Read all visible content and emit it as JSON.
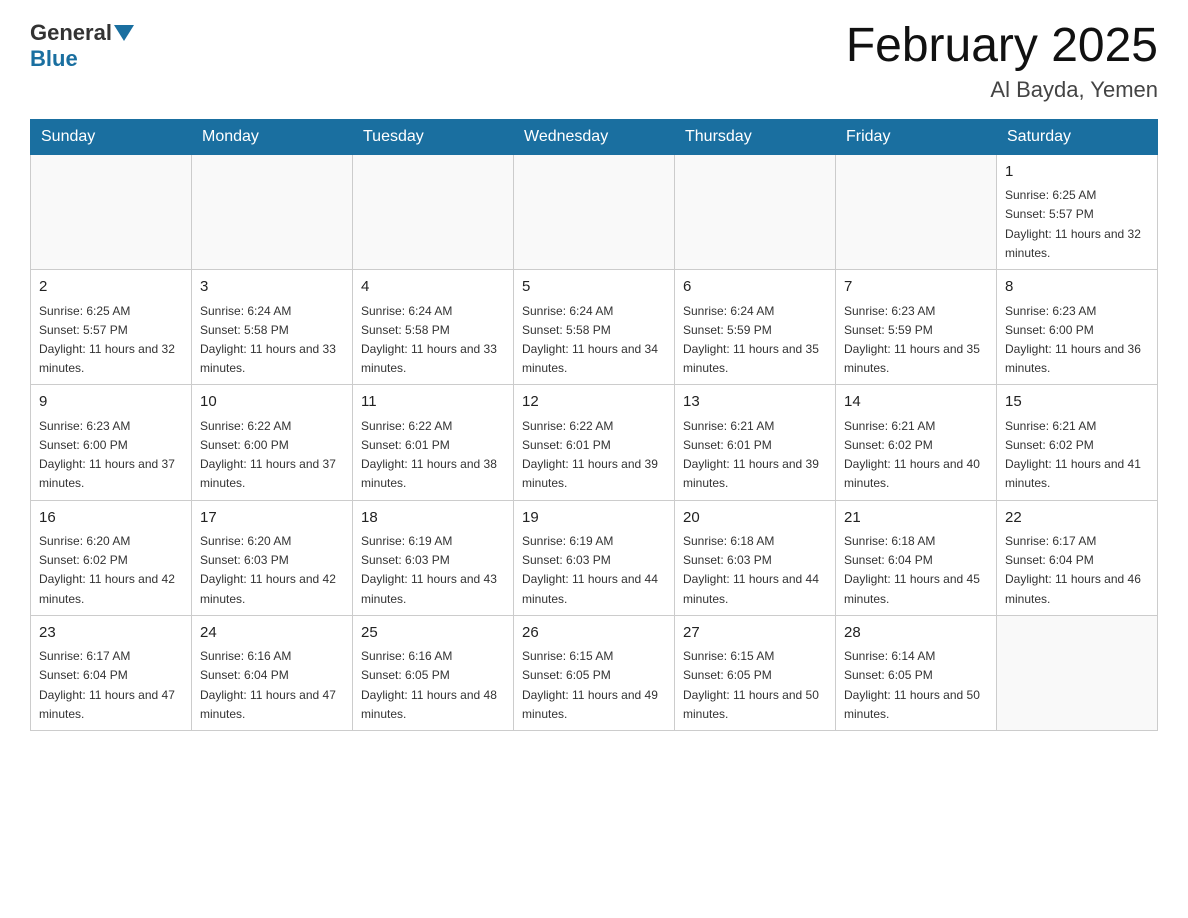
{
  "header": {
    "logo_general": "General",
    "logo_blue": "Blue",
    "title": "February 2025",
    "subtitle": "Al Bayda, Yemen"
  },
  "days_of_week": [
    "Sunday",
    "Monday",
    "Tuesday",
    "Wednesday",
    "Thursday",
    "Friday",
    "Saturday"
  ],
  "weeks": [
    [
      {
        "day": "",
        "info": ""
      },
      {
        "day": "",
        "info": ""
      },
      {
        "day": "",
        "info": ""
      },
      {
        "day": "",
        "info": ""
      },
      {
        "day": "",
        "info": ""
      },
      {
        "day": "",
        "info": ""
      },
      {
        "day": "1",
        "info": "Sunrise: 6:25 AM\nSunset: 5:57 PM\nDaylight: 11 hours and 32 minutes."
      }
    ],
    [
      {
        "day": "2",
        "info": "Sunrise: 6:25 AM\nSunset: 5:57 PM\nDaylight: 11 hours and 32 minutes."
      },
      {
        "day": "3",
        "info": "Sunrise: 6:24 AM\nSunset: 5:58 PM\nDaylight: 11 hours and 33 minutes."
      },
      {
        "day": "4",
        "info": "Sunrise: 6:24 AM\nSunset: 5:58 PM\nDaylight: 11 hours and 33 minutes."
      },
      {
        "day": "5",
        "info": "Sunrise: 6:24 AM\nSunset: 5:58 PM\nDaylight: 11 hours and 34 minutes."
      },
      {
        "day": "6",
        "info": "Sunrise: 6:24 AM\nSunset: 5:59 PM\nDaylight: 11 hours and 35 minutes."
      },
      {
        "day": "7",
        "info": "Sunrise: 6:23 AM\nSunset: 5:59 PM\nDaylight: 11 hours and 35 minutes."
      },
      {
        "day": "8",
        "info": "Sunrise: 6:23 AM\nSunset: 6:00 PM\nDaylight: 11 hours and 36 minutes."
      }
    ],
    [
      {
        "day": "9",
        "info": "Sunrise: 6:23 AM\nSunset: 6:00 PM\nDaylight: 11 hours and 37 minutes."
      },
      {
        "day": "10",
        "info": "Sunrise: 6:22 AM\nSunset: 6:00 PM\nDaylight: 11 hours and 37 minutes."
      },
      {
        "day": "11",
        "info": "Sunrise: 6:22 AM\nSunset: 6:01 PM\nDaylight: 11 hours and 38 minutes."
      },
      {
        "day": "12",
        "info": "Sunrise: 6:22 AM\nSunset: 6:01 PM\nDaylight: 11 hours and 39 minutes."
      },
      {
        "day": "13",
        "info": "Sunrise: 6:21 AM\nSunset: 6:01 PM\nDaylight: 11 hours and 39 minutes."
      },
      {
        "day": "14",
        "info": "Sunrise: 6:21 AM\nSunset: 6:02 PM\nDaylight: 11 hours and 40 minutes."
      },
      {
        "day": "15",
        "info": "Sunrise: 6:21 AM\nSunset: 6:02 PM\nDaylight: 11 hours and 41 minutes."
      }
    ],
    [
      {
        "day": "16",
        "info": "Sunrise: 6:20 AM\nSunset: 6:02 PM\nDaylight: 11 hours and 42 minutes."
      },
      {
        "day": "17",
        "info": "Sunrise: 6:20 AM\nSunset: 6:03 PM\nDaylight: 11 hours and 42 minutes."
      },
      {
        "day": "18",
        "info": "Sunrise: 6:19 AM\nSunset: 6:03 PM\nDaylight: 11 hours and 43 minutes."
      },
      {
        "day": "19",
        "info": "Sunrise: 6:19 AM\nSunset: 6:03 PM\nDaylight: 11 hours and 44 minutes."
      },
      {
        "day": "20",
        "info": "Sunrise: 6:18 AM\nSunset: 6:03 PM\nDaylight: 11 hours and 44 minutes."
      },
      {
        "day": "21",
        "info": "Sunrise: 6:18 AM\nSunset: 6:04 PM\nDaylight: 11 hours and 45 minutes."
      },
      {
        "day": "22",
        "info": "Sunrise: 6:17 AM\nSunset: 6:04 PM\nDaylight: 11 hours and 46 minutes."
      }
    ],
    [
      {
        "day": "23",
        "info": "Sunrise: 6:17 AM\nSunset: 6:04 PM\nDaylight: 11 hours and 47 minutes."
      },
      {
        "day": "24",
        "info": "Sunrise: 6:16 AM\nSunset: 6:04 PM\nDaylight: 11 hours and 47 minutes."
      },
      {
        "day": "25",
        "info": "Sunrise: 6:16 AM\nSunset: 6:05 PM\nDaylight: 11 hours and 48 minutes."
      },
      {
        "day": "26",
        "info": "Sunrise: 6:15 AM\nSunset: 6:05 PM\nDaylight: 11 hours and 49 minutes."
      },
      {
        "day": "27",
        "info": "Sunrise: 6:15 AM\nSunset: 6:05 PM\nDaylight: 11 hours and 50 minutes."
      },
      {
        "day": "28",
        "info": "Sunrise: 6:14 AM\nSunset: 6:05 PM\nDaylight: 11 hours and 50 minutes."
      },
      {
        "day": "",
        "info": ""
      }
    ]
  ]
}
